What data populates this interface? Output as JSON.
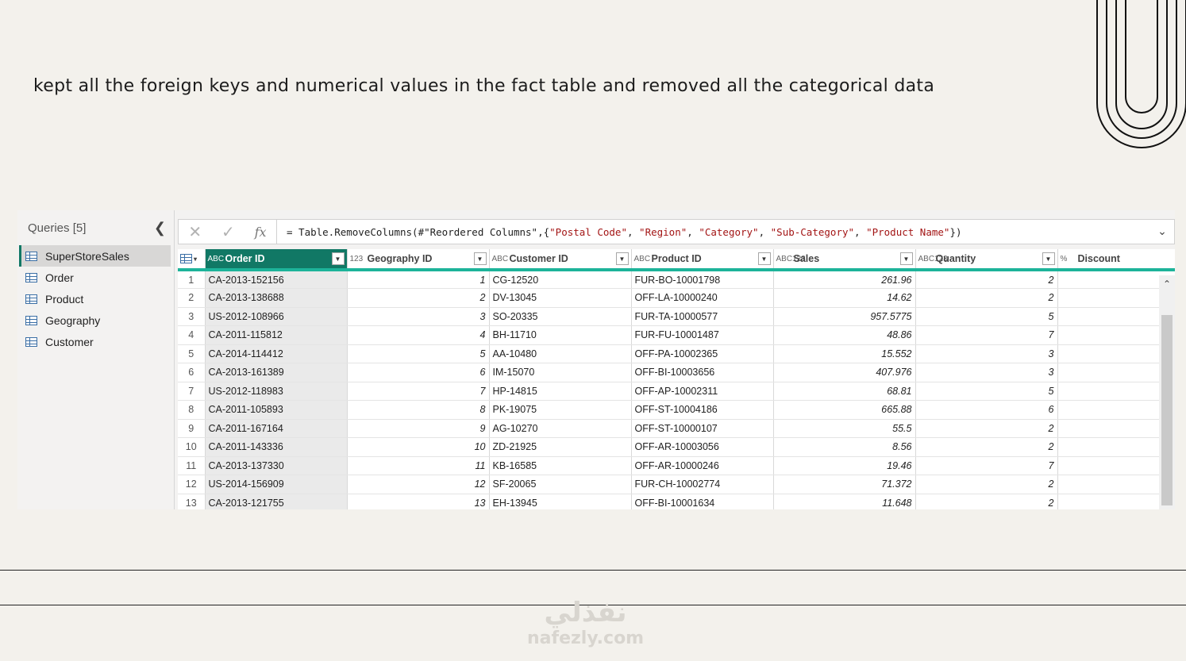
{
  "heading": "kept all the foreign keys and numerical values in the fact table and removed all the categorical data",
  "queries": {
    "title": "Queries [5]",
    "items": [
      {
        "label": "SuperStoreSales",
        "selected": true
      },
      {
        "label": "Order"
      },
      {
        "label": "Product"
      },
      {
        "label": "Geography"
      },
      {
        "label": "Customer"
      }
    ]
  },
  "formula": {
    "prefix": "= Table.RemoveColumns(#\"Reordered Columns\",{",
    "strings": [
      "\"Postal Code\"",
      "\"Region\"",
      "\"Category\"",
      "\"Sub-Category\"",
      "\"Product Name\""
    ],
    "suffix": "})"
  },
  "columns": [
    {
      "type": "ABC",
      "label": "Order ID"
    },
    {
      "type": "123",
      "label": "Geography ID"
    },
    {
      "type": "ABC",
      "label": "Customer ID"
    },
    {
      "type": "ABC",
      "label": "Product ID"
    },
    {
      "type": "ABC123",
      "label": "Sales"
    },
    {
      "type": "ABC123",
      "label": "Quantity"
    },
    {
      "type": "%",
      "label": "Discount"
    }
  ],
  "rows": [
    [
      "1",
      "CA-2013-152156",
      "1",
      "CG-12520",
      "FUR-BO-10001798",
      "261.96",
      "2",
      ""
    ],
    [
      "2",
      "CA-2013-138688",
      "2",
      "DV-13045",
      "OFF-LA-10000240",
      "14.62",
      "2",
      ""
    ],
    [
      "3",
      "US-2012-108966",
      "3",
      "SO-20335",
      "FUR-TA-10000577",
      "957.5775",
      "5",
      ""
    ],
    [
      "4",
      "CA-2011-115812",
      "4",
      "BH-11710",
      "FUR-FU-10001487",
      "48.86",
      "7",
      ""
    ],
    [
      "5",
      "CA-2014-114412",
      "5",
      "AA-10480",
      "OFF-PA-10002365",
      "15.552",
      "3",
      ""
    ],
    [
      "6",
      "CA-2013-161389",
      "6",
      "IM-15070",
      "OFF-BI-10003656",
      "407.976",
      "3",
      ""
    ],
    [
      "7",
      "US-2012-118983",
      "7",
      "HP-14815",
      "OFF-AP-10002311",
      "68.81",
      "5",
      ""
    ],
    [
      "8",
      "CA-2011-105893",
      "8",
      "PK-19075",
      "OFF-ST-10004186",
      "665.88",
      "6",
      ""
    ],
    [
      "9",
      "CA-2011-167164",
      "9",
      "AG-10270",
      "OFF-ST-10000107",
      "55.5",
      "2",
      ""
    ],
    [
      "10",
      "CA-2011-143336",
      "10",
      "ZD-21925",
      "OFF-AR-10003056",
      "8.56",
      "2",
      ""
    ],
    [
      "11",
      "CA-2013-137330",
      "11",
      "KB-16585",
      "OFF-AR-10000246",
      "19.46",
      "7",
      ""
    ],
    [
      "12",
      "US-2014-156909",
      "12",
      "SF-20065",
      "FUR-CH-10002774",
      "71.372",
      "2",
      ""
    ],
    [
      "13",
      "CA-2013-121755",
      "13",
      "EH-13945",
      "OFF-BI-10001634",
      "11.648",
      "2",
      ""
    ]
  ],
  "watermark": {
    "arabic": "نفذلي",
    "latin": "nafezly.com"
  },
  "colors": {
    "accent": "#117865",
    "header_rule": "#1db39a"
  }
}
